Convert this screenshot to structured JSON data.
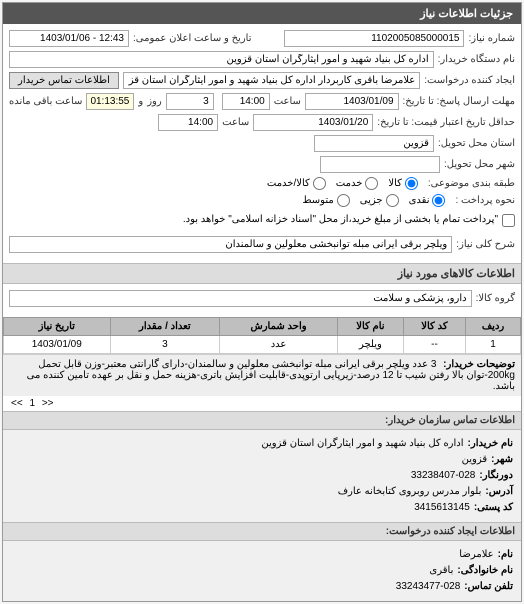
{
  "panel": {
    "title": "جزئیات اطلاعات نیاز"
  },
  "labels": {
    "need_no": "شماره نیاز:",
    "public_announce_dt": "تاریخ و ساعت اعلان عمومی:",
    "buyer_device": "نام دستگاه خریدار:",
    "request_creator": "ایجاد کننده درخواست:",
    "buyer_contact_btn": "اطلاعات تماس خریدار",
    "send_deadline": "مهلت ارسال پاسخ: تا تاریخ:",
    "time": "ساعت",
    "validity_deadline": "حداقل تاریخ اعتبار قیمت: تا تاریخ:",
    "remaining_time": "ساعت باقی مانده",
    "and": "و",
    "day": "روز",
    "request_province": "استان محل تحویل:",
    "request_city": "شهر محل تحویل:",
    "need_group": "طبقه بندی موضوعی:",
    "payment_method": "نحوه پرداخت :",
    "need_title": "شرح کلی نیاز:",
    "goods_group": "گروه کالا:",
    "buyer_desc": "توضیحات خریدار:"
  },
  "fields": {
    "need_no": "1102005085000015",
    "public_announce_dt": "12:43 - 1403/01/06",
    "buyer_device": "اداره کل بنیاد شهید و امور ایثارگران استان قزوین",
    "request_creator": "علامرضا باقری کاربردار اداره کل بنیاد شهید و امور ایثارگران استان قزوین",
    "send_deadline_date": "1403/01/09",
    "send_deadline_time": "14:00",
    "remaining_days": "3",
    "remaining_time": "01:13:55",
    "validity_date": "1403/01/20",
    "validity_time": "14:00",
    "request_province": "قزوین",
    "request_city": "",
    "need_title": "ویلچر برقی ایرانی مبله توانبخشی معلولین و سالمندان",
    "goods_group": "دارو، پزشکی و سلامت",
    "buyer_desc": "3 عدد ویلچر برقی ایرانی مبله توانبخشی معلولین و سالمندان-دارای گارانتی معتبر-وزن قابل تحمل 200kg-توان بالا رفتن شیب تا 12 درصد-زیرپایی ارتوپدی-قابلیت افزایش باتری-هزینه حمل و نقل بر عهده تامین کننده می باشد."
  },
  "radios": {
    "need_group": {
      "goods": "کالا",
      "service": "خدمت",
      "goods_service": "کالا/خدمت"
    },
    "payment": {
      "cash": "نقدی",
      "partial": "جزیی",
      "medium": "متوسط"
    }
  },
  "checkbox": {
    "payment_note": "\"پرداخت تمام یا بخشی از مبلغ خرید،از محل \"اسناد خزانه اسلامی\" خواهد بود."
  },
  "sections": {
    "goods_info": "اطلاعات کالاهای مورد نیاز",
    "org_contact": "اطلاعات تماس سازمان خریدار:",
    "req_contact": "اطلاعات ایجاد کننده درخواست:"
  },
  "table": {
    "headers": {
      "row": "ردیف",
      "code": "کد کالا",
      "name": "نام کالا",
      "unit": "واحد شمارش",
      "qty": "تعداد / مقدار",
      "date": "تاریخ نیاز"
    },
    "rows": [
      {
        "row": "1",
        "code": "--",
        "name": "ویلچر",
        "unit": "عدد",
        "qty": "3",
        "date": "1403/01/09"
      }
    ]
  },
  "pager": {
    "prev": "<<",
    "p1": "1",
    "next": ">>"
  },
  "contact_org": {
    "org_label": "نام خریدار:",
    "org": "اداره کل بنیاد شهید و امور ایثارگران استان قزوین",
    "province_label": "شهر:",
    "province": "قزوین",
    "fax_label": "دورنگار:",
    "fax": "33238407-028",
    "addr_label": "آدرس:",
    "addr": "بلوار مدرس روبروی کتابخانه عارف",
    "post_label": "کد پستی:",
    "post": "3415613145"
  },
  "contact_req": {
    "fname_label": "نام:",
    "fname": "علامرضا",
    "lname_label": "نام خانوادگی:",
    "lname": "باقری",
    "phone_label": "تلفن تماس:",
    "phone": "33243477-028"
  }
}
